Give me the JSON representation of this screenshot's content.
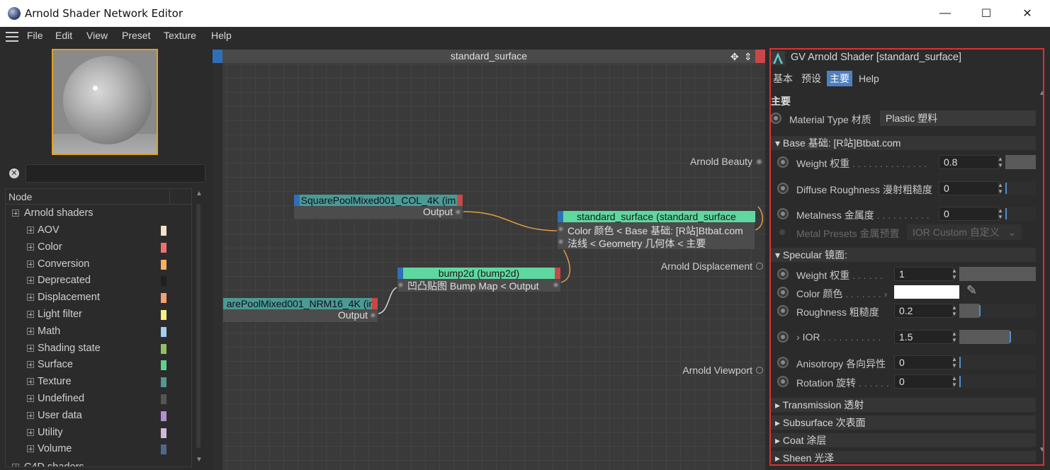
{
  "window": {
    "title": "Arnold Shader Network Editor",
    "minimize": "—",
    "maximize": "☐",
    "close": "✕"
  },
  "menu": [
    "File",
    "Edit",
    "View",
    "Preset",
    "Texture",
    "Help"
  ],
  "search": {
    "value": "",
    "placeholder": ""
  },
  "tree": {
    "header": "Node",
    "root": "Arnold shaders",
    "items": [
      {
        "label": "AOV",
        "color": "#f5e0c8"
      },
      {
        "label": "Color",
        "color": "#f07070"
      },
      {
        "label": "Conversion",
        "color": "#f5b060"
      },
      {
        "label": "Deprecated",
        "color": "#202020"
      },
      {
        "label": "Displacement",
        "color": "#f5a070"
      },
      {
        "label": "Light filter",
        "color": "#f5f080"
      },
      {
        "label": "Math",
        "color": "#a0d0f0"
      },
      {
        "label": "Shading state",
        "color": "#90c060"
      },
      {
        "label": "Surface",
        "color": "#60d090"
      },
      {
        "label": "Texture",
        "color": "#509890"
      },
      {
        "label": "Undefined",
        "color": "#555555"
      },
      {
        "label": "User data",
        "color": "#b090d0"
      },
      {
        "label": "Utility",
        "color": "#d0b8d8"
      },
      {
        "label": "Volume",
        "color": "#4a6a88"
      }
    ],
    "next_root": "C4D shaders"
  },
  "graph": {
    "title": "standard_surface",
    "nodes": {
      "col": {
        "title": "SquarePoolMixed001_COL_4K (im",
        "output": "Output"
      },
      "nrm": {
        "title": "arePoolMixed001_NRM16_4K (in",
        "output": "Output"
      },
      "bump": {
        "title": "bump2d (bump2d)",
        "port": "凹凸贴图 Bump Map <  Output"
      },
      "surface": {
        "title": "standard_surface (standard_surface",
        "port1": "Color 颜色 < Base 基础: [R站]Btbat.com",
        "port2": "法线 < Geometry 几何体 < 主要"
      }
    },
    "outputs": {
      "beauty": "Arnold Beauty",
      "displacement": "Arnold Displacement",
      "viewport": "Arnold Viewport"
    }
  },
  "attributes": {
    "title": "GV Arnold Shader [standard_surface]",
    "tabs": [
      "基本",
      "预设",
      "主要",
      "Help"
    ],
    "active_tab": "主要",
    "section": "主要",
    "material_type": {
      "label": "Material Type 材质",
      "value": "Plastic 塑料"
    },
    "base": {
      "header": "Base 基础: [R站]Btbat.com",
      "weight": {
        "label": "Weight 权重",
        "value": "0.8",
        "level": 0.8
      },
      "diffuse_roughness": {
        "label": "Diffuse Roughness 漫射粗糙度",
        "value": "0",
        "level": 0
      },
      "metalness": {
        "label": "Metalness 金属度",
        "value": "0",
        "level": 0
      },
      "metal_presets": {
        "label": "Metal Presets 金属预置",
        "value": "IOR Custom 自定义"
      }
    },
    "specular": {
      "header": "Specular 镜面:",
      "weight": {
        "label": "Weight 权重",
        "value": "1",
        "level": 1
      },
      "color": {
        "label": "Color 颜色",
        "value": "#ffffff"
      },
      "roughness": {
        "label": "Roughness 粗糙度",
        "value": "0.2",
        "level": 0.2
      },
      "ior": {
        "label": "IOR",
        "value": "1.5",
        "level": 0.5
      },
      "anisotropy": {
        "label": "Anisotropy 各向异性",
        "value": "0",
        "level": 0
      },
      "rotation": {
        "label": "Rotation 旋转",
        "value": "0",
        "level": 0
      }
    },
    "groups": [
      "Transmission 透射",
      "Subsurface 次表面",
      "Coat 涂层",
      "Sheen 光泽"
    ]
  }
}
